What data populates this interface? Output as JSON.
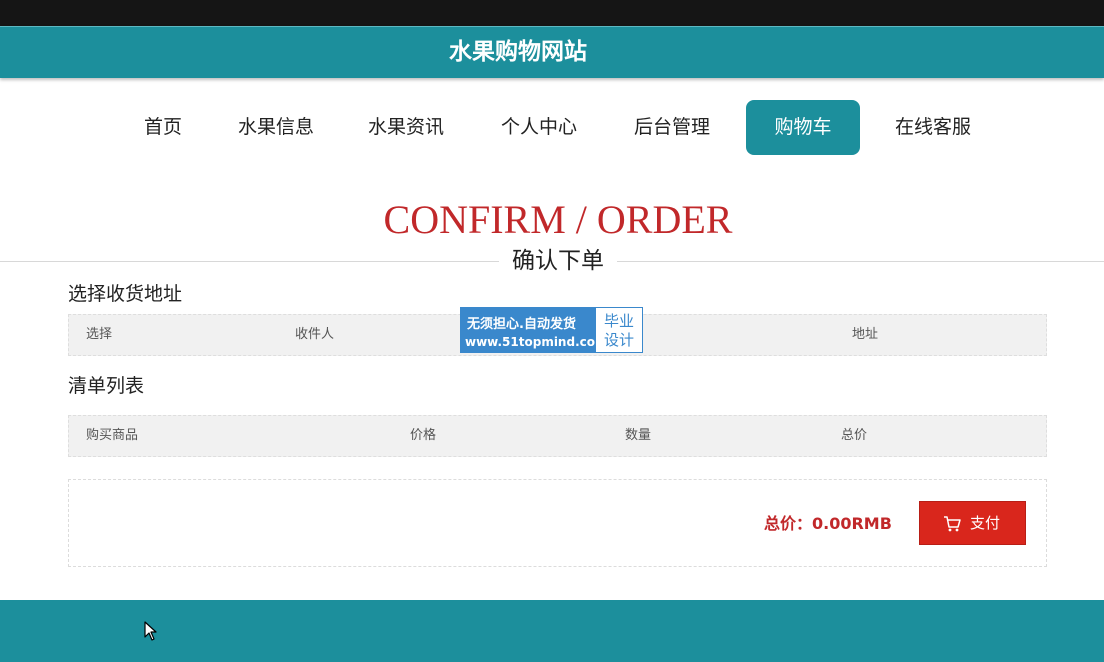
{
  "header": {
    "title": "水果购物网站"
  },
  "nav": {
    "items": [
      {
        "label": "首页"
      },
      {
        "label": "水果信息"
      },
      {
        "label": "水果资讯"
      },
      {
        "label": "个人中心"
      },
      {
        "label": "后台管理"
      },
      {
        "label": "购物车",
        "active": true
      },
      {
        "label": "在线客服"
      }
    ]
  },
  "hero": {
    "title_en": "CONFIRM / ORDER",
    "title_cn": "确认下单"
  },
  "address_section": {
    "title": "选择收货地址",
    "columns": [
      "选择",
      "收件人",
      "地址"
    ]
  },
  "list_section": {
    "title": "清单列表",
    "columns": [
      "购买商品",
      "价格",
      "数量",
      "总价"
    ]
  },
  "summary": {
    "total_text": "总价：0.00RMB",
    "pay_label": "支付"
  },
  "watermark": {
    "line1": "无须担心.自动发货",
    "line2": "www.51topmind.com",
    "side_line1": "毕业",
    "side_line2": "设计"
  },
  "icons": {
    "cart": "cart-icon",
    "cursor": "mouse-pointer-icon"
  },
  "colors": {
    "brand": "#1c8f9c",
    "accent": "#c1282a",
    "pay": "#d9261c"
  }
}
